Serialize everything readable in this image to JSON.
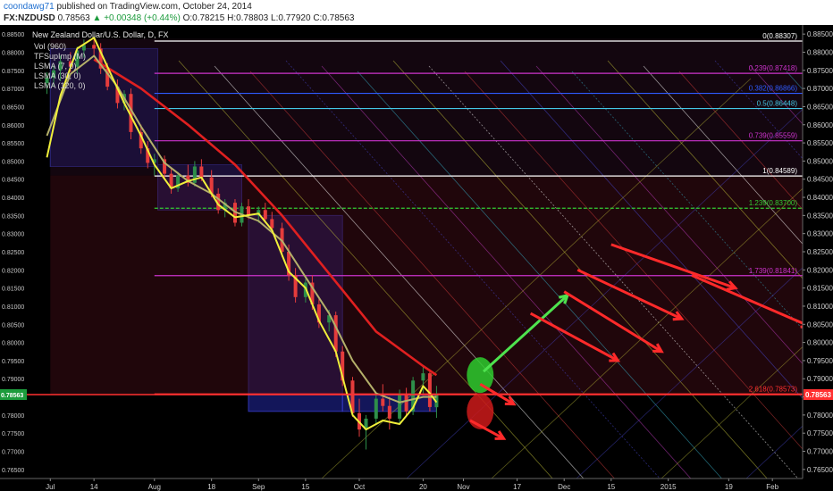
{
  "header": {
    "author": "coondawg71",
    "published_text": "published on TradingView.com, October 24, 2014",
    "symbol": "FX:NZDUSD",
    "last": "0.78563",
    "change_arrow": "▲",
    "change": "+0.00348 (+0.44%)",
    "open": "O:0.78215",
    "high": "H:0.78803",
    "low": "L:0.77920",
    "close": "C:0.78563"
  },
  "legend": {
    "title": "New Zealand Dollar/U.S. Dollar, D, FX",
    "lines": [
      "Vol (960)",
      "TFSupImp (M)",
      "LSMA (7, 0)",
      "LSMA (30, 0)",
      "LSMA (120, 0)"
    ]
  },
  "colors": {
    "background": "#000000",
    "up_candle": "#2e8f4a",
    "down_candle": "#e53c3c",
    "lsma_fast": "#f0ef3a",
    "lsma_mid": "#b4b06a",
    "lsma_slow": "#e02020",
    "price_line": "#ff3030",
    "arrow_up": "#4ee34e",
    "arrow_down": "#ff2a2a"
  },
  "chart_data": {
    "type": "candlestick",
    "symbol": "NZDUSD",
    "timeframe": "D",
    "ylim": [
      0.7625,
      0.8875
    ],
    "y_ticks": [
      "0.88500",
      "0.88000",
      "0.87500",
      "0.87000",
      "0.86500",
      "0.86000",
      "0.85500",
      "0.85000",
      "0.84500",
      "0.84000",
      "0.83500",
      "0.83000",
      "0.82500",
      "0.82000",
      "0.81500",
      "0.81000",
      "0.80500",
      "0.80000",
      "0.79500",
      "0.79000",
      "0.78500",
      "0.78000",
      "0.77500",
      "0.77000",
      "0.76500"
    ],
    "x_ticks": [
      {
        "label": "Jul",
        "date": "2014-07-01"
      },
      {
        "label": "14",
        "date": "2014-07-14"
      },
      {
        "label": "Aug",
        "date": "2014-08-01"
      },
      {
        "label": "18",
        "date": "2014-08-18"
      },
      {
        "label": "Sep",
        "date": "2014-09-01"
      },
      {
        "label": "15",
        "date": "2014-09-15"
      },
      {
        "label": "Oct",
        "date": "2014-10-01"
      },
      {
        "label": "20",
        "date": "2014-10-20"
      },
      {
        "label": "Nov",
        "date": "2014-11-01"
      },
      {
        "label": "17",
        "date": "2014-11-17"
      },
      {
        "label": "Dec",
        "date": "2014-12-01"
      },
      {
        "label": "15",
        "date": "2014-12-15"
      },
      {
        "label": "2015",
        "date": "2015-01-01"
      },
      {
        "label": "19",
        "date": "2015-01-19"
      },
      {
        "label": "Feb",
        "date": "2015-02-01"
      }
    ],
    "current_price": 0.78563,
    "current_price_label": "0.78563",
    "fib_levels": [
      {
        "label": "0(0.88307)",
        "value": 0.88307,
        "color": "#ffffff"
      },
      {
        "label": "0.239(0.87418)",
        "value": 0.87418,
        "color": "#cc33cc"
      },
      {
        "label": "0.382(0.86866)",
        "value": 0.86866,
        "color": "#2f5bff"
      },
      {
        "label": "0.5(0.86448)",
        "value": 0.86448,
        "color": "#44c6e6"
      },
      {
        "label": "0.739(0.85559)",
        "value": 0.85559,
        "color": "#cc33cc"
      },
      {
        "label": "1(0.84589)",
        "value": 0.84589,
        "color": "#ffffff"
      },
      {
        "label": "1.239(0.83700)",
        "value": 0.837,
        "color": "#33cc33"
      },
      {
        "label": "1.739(0.81841)",
        "value": 0.81841,
        "color": "#cc33cc"
      },
      {
        "label": "2.618(0.78573)",
        "value": 0.78573,
        "color": "#ff3030"
      }
    ],
    "candles": [
      {
        "date": "2014-06-30",
        "open": 0.8715,
        "high": 0.8745,
        "low": 0.8685,
        "close": 0.873
      },
      {
        "date": "2014-07-02",
        "open": 0.873,
        "high": 0.8765,
        "low": 0.8705,
        "close": 0.875
      },
      {
        "date": "2014-07-04",
        "open": 0.875,
        "high": 0.879,
        "low": 0.872,
        "close": 0.8775
      },
      {
        "date": "2014-07-07",
        "open": 0.8775,
        "high": 0.88,
        "low": 0.8745,
        "close": 0.876
      },
      {
        "date": "2014-07-09",
        "open": 0.876,
        "high": 0.8815,
        "low": 0.874,
        "close": 0.8805
      },
      {
        "date": "2014-07-11",
        "open": 0.8805,
        "high": 0.8835,
        "low": 0.8785,
        "close": 0.882
      },
      {
        "date": "2014-07-14",
        "open": 0.882,
        "high": 0.884,
        "low": 0.879,
        "close": 0.881
      },
      {
        "date": "2014-07-16",
        "open": 0.881,
        "high": 0.8825,
        "low": 0.874,
        "close": 0.8755
      },
      {
        "date": "2014-07-18",
        "open": 0.8755,
        "high": 0.877,
        "low": 0.8695,
        "close": 0.8705
      },
      {
        "date": "2014-07-21",
        "open": 0.8705,
        "high": 0.8725,
        "low": 0.8645,
        "close": 0.866
      },
      {
        "date": "2014-07-23",
        "open": 0.866,
        "high": 0.8695,
        "low": 0.864,
        "close": 0.8685
      },
      {
        "date": "2014-07-25",
        "open": 0.8685,
        "high": 0.87,
        "low": 0.856,
        "close": 0.858
      },
      {
        "date": "2014-07-28",
        "open": 0.858,
        "high": 0.86,
        "low": 0.852,
        "close": 0.8535
      },
      {
        "date": "2014-07-30",
        "open": 0.8535,
        "high": 0.8555,
        "low": 0.848,
        "close": 0.8495
      },
      {
        "date": "2014-08-01",
        "open": 0.8495,
        "high": 0.852,
        "low": 0.846,
        "close": 0.8505
      },
      {
        "date": "2014-08-04",
        "open": 0.8505,
        "high": 0.8515,
        "low": 0.845,
        "close": 0.8465
      },
      {
        "date": "2014-08-06",
        "open": 0.8465,
        "high": 0.848,
        "low": 0.841,
        "close": 0.8425
      },
      {
        "date": "2014-08-08",
        "open": 0.8425,
        "high": 0.847,
        "low": 0.8415,
        "close": 0.846
      },
      {
        "date": "2014-08-11",
        "open": 0.846,
        "high": 0.849,
        "low": 0.843,
        "close": 0.844
      },
      {
        "date": "2014-08-13",
        "open": 0.844,
        "high": 0.85,
        "low": 0.843,
        "close": 0.8485
      },
      {
        "date": "2014-08-15",
        "open": 0.8485,
        "high": 0.8505,
        "low": 0.8445,
        "close": 0.8455
      },
      {
        "date": "2014-08-18",
        "open": 0.8455,
        "high": 0.8475,
        "low": 0.84,
        "close": 0.841
      },
      {
        "date": "2014-08-20",
        "open": 0.841,
        "high": 0.8425,
        "low": 0.8355,
        "close": 0.8365
      },
      {
        "date": "2014-08-22",
        "open": 0.8365,
        "high": 0.8395,
        "low": 0.8345,
        "close": 0.8385
      },
      {
        "date": "2014-08-25",
        "open": 0.8385,
        "high": 0.8395,
        "low": 0.832,
        "close": 0.833
      },
      {
        "date": "2014-08-27",
        "open": 0.833,
        "high": 0.8385,
        "low": 0.832,
        "close": 0.8375
      },
      {
        "date": "2014-08-29",
        "open": 0.8375,
        "high": 0.8395,
        "low": 0.834,
        "close": 0.835
      },
      {
        "date": "2014-09-01",
        "open": 0.835,
        "high": 0.8375,
        "low": 0.833,
        "close": 0.8365
      },
      {
        "date": "2014-09-03",
        "open": 0.8365,
        "high": 0.8385,
        "low": 0.833,
        "close": 0.834
      },
      {
        "date": "2014-09-05",
        "open": 0.834,
        "high": 0.836,
        "low": 0.83,
        "close": 0.8315
      },
      {
        "date": "2014-09-08",
        "open": 0.8315,
        "high": 0.833,
        "low": 0.8235,
        "close": 0.825
      },
      {
        "date": "2014-09-10",
        "open": 0.825,
        "high": 0.827,
        "low": 0.817,
        "close": 0.8185
      },
      {
        "date": "2014-09-12",
        "open": 0.8185,
        "high": 0.8205,
        "low": 0.811,
        "close": 0.8125
      },
      {
        "date": "2014-09-15",
        "open": 0.8125,
        "high": 0.8175,
        "low": 0.811,
        "close": 0.8165
      },
      {
        "date": "2014-09-17",
        "open": 0.8165,
        "high": 0.8185,
        "low": 0.809,
        "close": 0.8105
      },
      {
        "date": "2014-09-19",
        "open": 0.8105,
        "high": 0.812,
        "low": 0.804,
        "close": 0.8055
      },
      {
        "date": "2014-09-22",
        "open": 0.8055,
        "high": 0.809,
        "low": 0.803,
        "close": 0.8075
      },
      {
        "date": "2014-09-24",
        "open": 0.8075,
        "high": 0.8085,
        "low": 0.796,
        "close": 0.7975
      },
      {
        "date": "2014-09-26",
        "open": 0.7975,
        "high": 0.799,
        "low": 0.788,
        "close": 0.7895
      },
      {
        "date": "2014-09-29",
        "open": 0.7895,
        "high": 0.7905,
        "low": 0.7795,
        "close": 0.7805
      },
      {
        "date": "2014-10-01",
        "open": 0.7805,
        "high": 0.7845,
        "low": 0.774,
        "close": 0.776
      },
      {
        "date": "2014-10-03",
        "open": 0.776,
        "high": 0.78,
        "low": 0.7705,
        "close": 0.779
      },
      {
        "date": "2014-10-06",
        "open": 0.779,
        "high": 0.786,
        "low": 0.7775,
        "close": 0.7845
      },
      {
        "date": "2014-10-08",
        "open": 0.7845,
        "high": 0.7885,
        "low": 0.781,
        "close": 0.7825
      },
      {
        "date": "2014-10-10",
        "open": 0.7825,
        "high": 0.785,
        "low": 0.776,
        "close": 0.779
      },
      {
        "date": "2014-10-13",
        "open": 0.779,
        "high": 0.787,
        "low": 0.7775,
        "close": 0.7855
      },
      {
        "date": "2014-10-15",
        "open": 0.7855,
        "high": 0.7875,
        "low": 0.7795,
        "close": 0.781
      },
      {
        "date": "2014-10-17",
        "open": 0.781,
        "high": 0.7905,
        "low": 0.78,
        "close": 0.7895
      },
      {
        "date": "2014-10-20",
        "open": 0.7895,
        "high": 0.7935,
        "low": 0.786,
        "close": 0.7915
      },
      {
        "date": "2014-10-22",
        "open": 0.7915,
        "high": 0.7925,
        "low": 0.781,
        "close": 0.7822
      },
      {
        "date": "2014-10-24",
        "open": 0.78215,
        "high": 0.78803,
        "low": 0.7792,
        "close": 0.78563
      }
    ],
    "lsma_fast": [
      {
        "date": "2014-06-30",
        "value": 0.851
      },
      {
        "date": "2014-07-04",
        "value": 0.868
      },
      {
        "date": "2014-07-09",
        "value": 0.881
      },
      {
        "date": "2014-07-14",
        "value": 0.884
      },
      {
        "date": "2014-07-18",
        "value": 0.876
      },
      {
        "date": "2014-07-23",
        "value": 0.866
      },
      {
        "date": "2014-07-28",
        "value": 0.857
      },
      {
        "date": "2014-08-01",
        "value": 0.849
      },
      {
        "date": "2014-08-06",
        "value": 0.8425
      },
      {
        "date": "2014-08-11",
        "value": 0.8445
      },
      {
        "date": "2014-08-15",
        "value": 0.8455
      },
      {
        "date": "2014-08-20",
        "value": 0.838
      },
      {
        "date": "2014-08-25",
        "value": 0.8345
      },
      {
        "date": "2014-09-01",
        "value": 0.8355
      },
      {
        "date": "2014-09-05",
        "value": 0.831
      },
      {
        "date": "2014-09-10",
        "value": 0.8195
      },
      {
        "date": "2014-09-15",
        "value": 0.815
      },
      {
        "date": "2014-09-19",
        "value": 0.806
      },
      {
        "date": "2014-09-24",
        "value": 0.7975
      },
      {
        "date": "2014-09-29",
        "value": 0.78
      },
      {
        "date": "2014-10-03",
        "value": 0.776
      },
      {
        "date": "2014-10-08",
        "value": 0.7785
      },
      {
        "date": "2014-10-13",
        "value": 0.7775
      },
      {
        "date": "2014-10-17",
        "value": 0.782
      },
      {
        "date": "2014-10-20",
        "value": 0.788
      },
      {
        "date": "2014-10-22",
        "value": 0.786
      },
      {
        "date": "2014-10-24",
        "value": 0.7835
      }
    ],
    "lsma_mid": [
      {
        "date": "2014-06-30",
        "value": 0.857
      },
      {
        "date": "2014-07-07",
        "value": 0.874
      },
      {
        "date": "2014-07-14",
        "value": 0.879
      },
      {
        "date": "2014-07-21",
        "value": 0.8705
      },
      {
        "date": "2014-07-28",
        "value": 0.8595
      },
      {
        "date": "2014-08-04",
        "value": 0.8495
      },
      {
        "date": "2014-08-11",
        "value": 0.8445
      },
      {
        "date": "2014-08-18",
        "value": 0.841
      },
      {
        "date": "2014-08-25",
        "value": 0.836
      },
      {
        "date": "2014-09-01",
        "value": 0.8335
      },
      {
        "date": "2014-09-08",
        "value": 0.828
      },
      {
        "date": "2014-09-15",
        "value": 0.818
      },
      {
        "date": "2014-09-22",
        "value": 0.808
      },
      {
        "date": "2014-09-29",
        "value": 0.795
      },
      {
        "date": "2014-10-06",
        "value": 0.786
      },
      {
        "date": "2014-10-13",
        "value": 0.7835
      },
      {
        "date": "2014-10-20",
        "value": 0.785
      },
      {
        "date": "2014-10-24",
        "value": 0.785
      }
    ],
    "lsma_slow": [
      {
        "date": "2014-07-14",
        "value": 0.878
      },
      {
        "date": "2014-07-28",
        "value": 0.87
      },
      {
        "date": "2014-08-11",
        "value": 0.86
      },
      {
        "date": "2014-08-25",
        "value": 0.849
      },
      {
        "date": "2014-09-08",
        "value": 0.835
      },
      {
        "date": "2014-09-22",
        "value": 0.819
      },
      {
        "date": "2014-10-06",
        "value": 0.803
      },
      {
        "date": "2014-10-20",
        "value": 0.7935
      },
      {
        "date": "2014-10-24",
        "value": 0.791
      }
    ],
    "projection_arrows": [
      {
        "direction": "up",
        "from": {
          "date": "2014-11-07",
          "price": 0.792
        },
        "to": {
          "date": "2014-12-02",
          "price": 0.813
        },
        "color": "#4ee34e"
      },
      {
        "direction": "down",
        "from": {
          "date": "2014-11-06",
          "price": 0.7885
        },
        "to": {
          "date": "2014-11-16",
          "price": 0.783
        },
        "color": "#ff2a2a"
      },
      {
        "direction": "down",
        "from": {
          "date": "2014-11-03",
          "price": 0.7785
        },
        "to": {
          "date": "2014-11-13",
          "price": 0.7735
        },
        "color": "#ff2a2a"
      },
      {
        "direction": "down",
        "from": {
          "date": "2014-11-21",
          "price": 0.808
        },
        "to": {
          "date": "2014-12-17",
          "price": 0.795
        },
        "color": "#ff2a2a"
      },
      {
        "direction": "down",
        "from": {
          "date": "2014-12-01",
          "price": 0.814
        },
        "to": {
          "date": "2014-12-30",
          "price": 0.7975
        },
        "color": "#ff2a2a"
      },
      {
        "direction": "down",
        "from": {
          "date": "2014-12-05",
          "price": 0.82
        },
        "to": {
          "date": "2015-01-05",
          "price": 0.8065
        },
        "color": "#ff2a2a"
      },
      {
        "direction": "down",
        "from": {
          "date": "2014-12-15",
          "price": 0.827
        },
        "to": {
          "date": "2015-01-21",
          "price": 0.815
        },
        "color": "#ff2a2a"
      },
      {
        "direction": "down",
        "from": {
          "date": "2015-01-08",
          "price": 0.8185
        },
        "to": {
          "date": "2015-02-12",
          "price": 0.8045
        },
        "color": "#ff2a2a"
      }
    ],
    "circles": [
      {
        "date": "2014-11-06",
        "price": 0.791,
        "color": "#2ecc2e"
      },
      {
        "date": "2014-11-06",
        "price": 0.781,
        "color": "#cc1a1a"
      }
    ]
  }
}
